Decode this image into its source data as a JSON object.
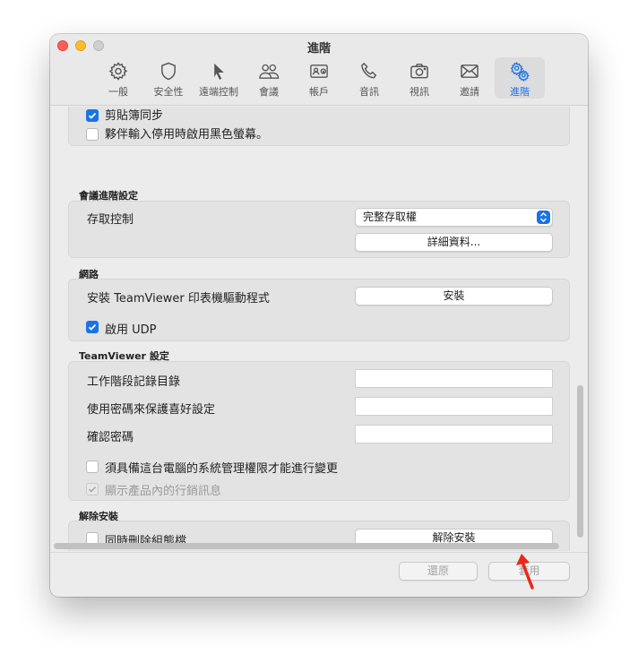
{
  "window": {
    "title": "進階"
  },
  "toolbar": {
    "items": [
      {
        "label": "一般",
        "icon": "gear-icon"
      },
      {
        "label": "安全性",
        "icon": "shield-icon"
      },
      {
        "label": "遠端控制",
        "icon": "cursor-icon"
      },
      {
        "label": "會議",
        "icon": "people-icon"
      },
      {
        "label": "帳戶",
        "icon": "id-card-icon"
      },
      {
        "label": "音訊",
        "icon": "phone-icon"
      },
      {
        "label": "視訊",
        "icon": "camera-icon"
      },
      {
        "label": "邀請",
        "icon": "envelope-icon"
      },
      {
        "label": "進階",
        "icon": "gears-icon",
        "active": true
      }
    ]
  },
  "top_box": {
    "clipboard_sync": {
      "label": "剪貼簿同步",
      "checked": true
    },
    "black_screen": {
      "label": "夥伴輸入停用時啟用黑色螢幕。",
      "checked": false
    }
  },
  "meeting_advanced": {
    "title": "會議進階設定",
    "access_control_label": "存取控制",
    "access_control_value": "完整存取權",
    "details_button": "詳細資料..."
  },
  "network": {
    "title": "網路",
    "printer_driver_label": "安裝 TeamViewer 印表機驅動程式",
    "install_button": "安裝",
    "enable_udp": {
      "label": "啟用 UDP",
      "checked": true
    }
  },
  "teamviewer_settings": {
    "title": "TeamViewer 設定",
    "log_dir_label": "工作階段記錄目錄",
    "log_dir_value": "",
    "password_protect_label": "使用密碼來保護喜好設定",
    "password_value": "",
    "confirm_password_label": "確認密碼",
    "confirm_password_value": "",
    "admin_rights": {
      "label": "須具備這台電腦的系統管理權限才能進行變更",
      "checked": false
    },
    "marketing": {
      "label": "顯示產品內的行銷訊息",
      "checked": true,
      "disabled": true
    }
  },
  "uninstall": {
    "title": "解除安裝",
    "delete_config": {
      "label": "同時刪除組態檔",
      "checked": false
    },
    "uninstall_button": "解除安裝"
  },
  "footer": {
    "revert_button": "還原",
    "apply_button": "套用"
  },
  "colors": {
    "accent": "#1a73e8",
    "annotation_arrow": "#e8291c"
  }
}
